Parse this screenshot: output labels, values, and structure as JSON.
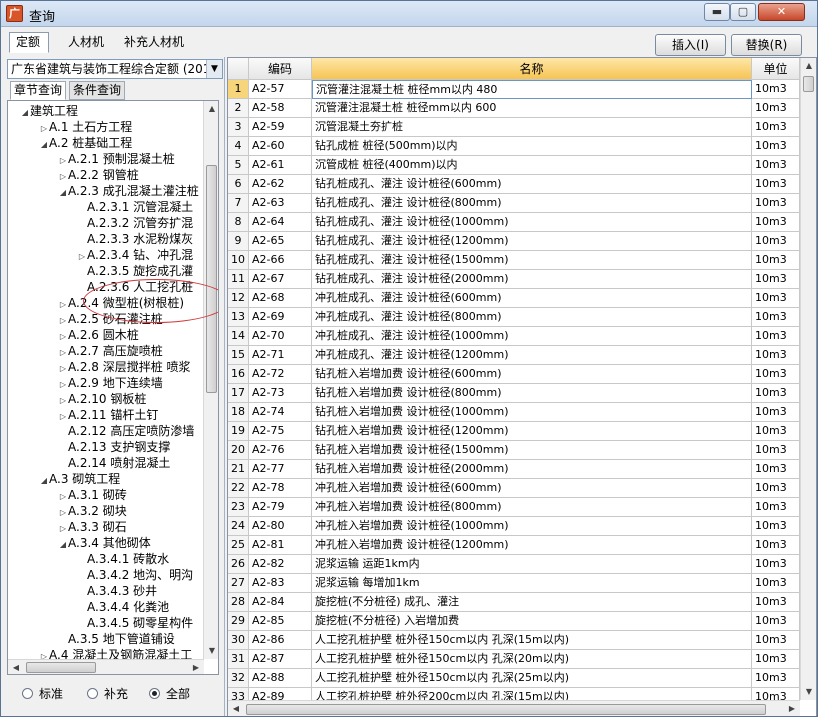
{
  "window": {
    "title": "查询",
    "min_glyph": "▬",
    "max_glyph": "▢",
    "close_glyph": "✕",
    "app_glyph": "广"
  },
  "tabs": [
    "定额",
    "人材机",
    "补充人材机"
  ],
  "buttons": {
    "insert": "插入(I)",
    "replace": "替换(R)"
  },
  "library_select": {
    "value": "广东省建筑与装饰工程综合定额 (201",
    "arrow": "▼"
  },
  "subtabs": [
    "章节查询",
    "条件查询"
  ],
  "tree": [
    {
      "label": "建筑工程",
      "arrow": "◢"
    },
    {
      "label": "A.1  土石方工程",
      "arrow": "▷"
    },
    {
      "label": "A.2  桩基础工程",
      "arrow": "◢"
    },
    {
      "label": "A.2.1  预制混凝土桩",
      "arrow": "▷"
    },
    {
      "label": "A.2.2  钢管桩",
      "arrow": "▷"
    },
    {
      "label": "A.2.3  成孔混凝土灌注桩",
      "arrow": "◢"
    },
    {
      "label": "A.2.3.1  沉管混凝土",
      "arrow": ""
    },
    {
      "label": "A.2.3.2  沉管夯扩混",
      "arrow": ""
    },
    {
      "label": "A.2.3.3  水泥粉煤灰",
      "arrow": ""
    },
    {
      "label": "A.2.3.4  钻、冲孔混",
      "arrow": "▷"
    },
    {
      "label": "A.2.3.5  旋挖成孔灌",
      "arrow": ""
    },
    {
      "label": "A.2.3.6  人工挖孔桩",
      "arrow": ""
    },
    {
      "label": "A.2.4  微型桩(树根桩)",
      "arrow": "▷"
    },
    {
      "label": "A.2.5  砂石灌注桩",
      "arrow": "▷"
    },
    {
      "label": "A.2.6  圆木桩",
      "arrow": "▷"
    },
    {
      "label": "A.2.7  高压旋喷桩",
      "arrow": "▷"
    },
    {
      "label": "A.2.8  深层搅拌桩 喷浆",
      "arrow": "▷"
    },
    {
      "label": "A.2.9  地下连续墙",
      "arrow": "▷"
    },
    {
      "label": "A.2.10  钢板桩",
      "arrow": "▷"
    },
    {
      "label": "A.2.11  锚杆土钉",
      "arrow": "▷"
    },
    {
      "label": "A.2.12  高压定喷防渗墙",
      "arrow": ""
    },
    {
      "label": "A.2.13  支护钢支撑",
      "arrow": ""
    },
    {
      "label": "A.2.14  喷射混凝土",
      "arrow": ""
    },
    {
      "label": "A.3  砌筑工程",
      "arrow": "◢"
    },
    {
      "label": "A.3.1  砌砖",
      "arrow": "▷"
    },
    {
      "label": "A.3.2  砌块",
      "arrow": "▷"
    },
    {
      "label": "A.3.3  砌石",
      "arrow": "▷"
    },
    {
      "label": "A.3.4  其他砌体",
      "arrow": "◢"
    },
    {
      "label": "A.3.4.1  砖散水",
      "arrow": ""
    },
    {
      "label": "A.3.4.2  地沟、明沟",
      "arrow": ""
    },
    {
      "label": "A.3.4.3  砂井",
      "arrow": ""
    },
    {
      "label": "A.3.4.4  化粪池",
      "arrow": ""
    },
    {
      "label": "A.3.4.5  砌零星构件",
      "arrow": ""
    },
    {
      "label": "A.3.5  地下管道铺设",
      "arrow": ""
    },
    {
      "label": "A.4  混凝土及钢筋混凝土工",
      "arrow": "▷"
    }
  ],
  "scroll_glyphs": {
    "up": "▲",
    "down": "▼",
    "left": "◀",
    "right": "▶"
  },
  "radios": [
    {
      "label": "标准",
      "checked": false
    },
    {
      "label": "补充",
      "checked": false
    },
    {
      "label": "全部",
      "checked": true
    }
  ],
  "grid": {
    "columns": [
      "",
      "编码",
      "名称",
      "单位"
    ],
    "rows": [
      {
        "idx": "1",
        "code": "A2-57",
        "name": "沉管灌注混凝土桩 桩径mm以内 480",
        "unit": "10m3"
      },
      {
        "idx": "2",
        "code": "A2-58",
        "name": "沉管灌注混凝土桩 桩径mm以内 600",
        "unit": "10m3"
      },
      {
        "idx": "3",
        "code": "A2-59",
        "name": "沉管混凝土夯扩桩",
        "unit": "10m3"
      },
      {
        "idx": "4",
        "code": "A2-60",
        "name": "钻孔成桩 桩径(500mm)以内",
        "unit": "10m3"
      },
      {
        "idx": "5",
        "code": "A2-61",
        "name": "沉管成桩 桩径(400mm)以内",
        "unit": "10m3"
      },
      {
        "idx": "6",
        "code": "A2-62",
        "name": "钻孔桩成孔、灌注 设计桩径(600mm)",
        "unit": "10m3"
      },
      {
        "idx": "7",
        "code": "A2-63",
        "name": "钻孔桩成孔、灌注 设计桩径(800mm)",
        "unit": "10m3"
      },
      {
        "idx": "8",
        "code": "A2-64",
        "name": "钻孔桩成孔、灌注 设计桩径(1000mm)",
        "unit": "10m3"
      },
      {
        "idx": "9",
        "code": "A2-65",
        "name": "钻孔桩成孔、灌注 设计桩径(1200mm)",
        "unit": "10m3"
      },
      {
        "idx": "10",
        "code": "A2-66",
        "name": "钻孔桩成孔、灌注 设计桩径(1500mm)",
        "unit": "10m3"
      },
      {
        "idx": "11",
        "code": "A2-67",
        "name": "钻孔桩成孔、灌注 设计桩径(2000mm)",
        "unit": "10m3"
      },
      {
        "idx": "12",
        "code": "A2-68",
        "name": "冲孔桩成孔、灌注 设计桩径(600mm)",
        "unit": "10m3"
      },
      {
        "idx": "13",
        "code": "A2-69",
        "name": "冲孔桩成孔、灌注 设计桩径(800mm)",
        "unit": "10m3"
      },
      {
        "idx": "14",
        "code": "A2-70",
        "name": "冲孔桩成孔、灌注 设计桩径(1000mm)",
        "unit": "10m3"
      },
      {
        "idx": "15",
        "code": "A2-71",
        "name": "冲孔桩成孔、灌注 设计桩径(1200mm)",
        "unit": "10m3"
      },
      {
        "idx": "16",
        "code": "A2-72",
        "name": "钻孔桩入岩增加费 设计桩径(600mm)",
        "unit": "10m3"
      },
      {
        "idx": "17",
        "code": "A2-73",
        "name": "钻孔桩入岩增加费 设计桩径(800mm)",
        "unit": "10m3"
      },
      {
        "idx": "18",
        "code": "A2-74",
        "name": "钻孔桩入岩增加费 设计桩径(1000mm)",
        "unit": "10m3"
      },
      {
        "idx": "19",
        "code": "A2-75",
        "name": "钻孔桩入岩增加费 设计桩径(1200mm)",
        "unit": "10m3"
      },
      {
        "idx": "20",
        "code": "A2-76",
        "name": "钻孔桩入岩增加费 设计桩径(1500mm)",
        "unit": "10m3"
      },
      {
        "idx": "21",
        "code": "A2-77",
        "name": "钻孔桩入岩增加费 设计桩径(2000mm)",
        "unit": "10m3"
      },
      {
        "idx": "22",
        "code": "A2-78",
        "name": "冲孔桩入岩增加费 设计桩径(600mm)",
        "unit": "10m3"
      },
      {
        "idx": "23",
        "code": "A2-79",
        "name": "冲孔桩入岩增加费 设计桩径(800mm)",
        "unit": "10m3"
      },
      {
        "idx": "24",
        "code": "A2-80",
        "name": "冲孔桩入岩增加费 设计桩径(1000mm)",
        "unit": "10m3"
      },
      {
        "idx": "25",
        "code": "A2-81",
        "name": "冲孔桩入岩增加费 设计桩径(1200mm)",
        "unit": "10m3"
      },
      {
        "idx": "26",
        "code": "A2-82",
        "name": "泥浆运输 运距1km内",
        "unit": "10m3"
      },
      {
        "idx": "27",
        "code": "A2-83",
        "name": "泥浆运输 每增加1km",
        "unit": "10m3"
      },
      {
        "idx": "28",
        "code": "A2-84",
        "name": "旋挖桩(不分桩径) 成孔、灌注",
        "unit": "10m3"
      },
      {
        "idx": "29",
        "code": "A2-85",
        "name": "旋挖桩(不分桩径) 入岩增加费",
        "unit": "10m3"
      },
      {
        "idx": "30",
        "code": "A2-86",
        "name": "人工挖孔桩护壁 桩外径150cm以内 孔深(15m以内)",
        "unit": "10m3"
      },
      {
        "idx": "31",
        "code": "A2-87",
        "name": "人工挖孔桩护壁 桩外径150cm以内 孔深(20m以内)",
        "unit": "10m3"
      },
      {
        "idx": "32",
        "code": "A2-88",
        "name": "人工挖孔桩护壁 桩外径150cm以内 孔深(25m以内)",
        "unit": "10m3"
      },
      {
        "idx": "33",
        "code": "A2-89",
        "name": "人工挖孔桩护壁 桩外径200cm以内 孔深(15m以内)",
        "unit": "10m3"
      }
    ]
  },
  "colors": {
    "selection": "#f7d57a",
    "highlight_ring": "#d2363a",
    "header_selected": "#f7c453"
  }
}
